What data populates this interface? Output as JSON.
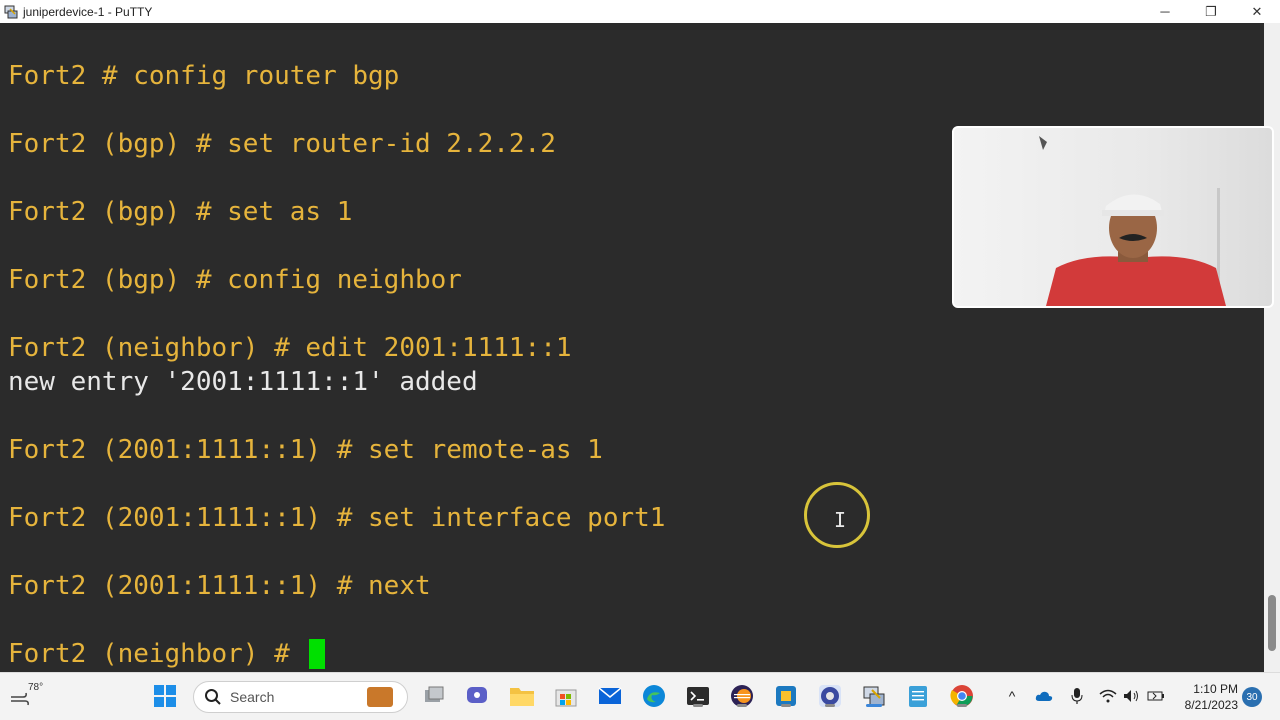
{
  "window": {
    "title": "juniperdevice-1 - PuTTY",
    "minimize_label": "─",
    "maximize_label": "❐",
    "close_label": "✕"
  },
  "terminal": {
    "lines": [
      {
        "text": "Fort2 # config router bgp",
        "kind": "prompt"
      },
      {
        "text": "Fort2 (bgp) # set router-id 2.2.2.2",
        "kind": "prompt"
      },
      {
        "text": "Fort2 (bgp) # set as 1",
        "kind": "prompt"
      },
      {
        "text": "Fort2 (bgp) # config neighbor",
        "kind": "prompt"
      },
      {
        "text": "Fort2 (neighbor) # edit 2001:1111::1",
        "kind": "prompt"
      },
      {
        "text": "new entry '2001:1111::1' added",
        "kind": "output"
      },
      {
        "text": "Fort2 (2001:1111::1) # set remote-as 1",
        "kind": "prompt"
      },
      {
        "text": "Fort2 (2001:1111::1) # set interface port1",
        "kind": "prompt"
      },
      {
        "text": "Fort2 (2001:1111::1) # next",
        "kind": "prompt"
      },
      {
        "text": "Fort2 (neighbor) # ",
        "kind": "prompt"
      }
    ]
  },
  "taskbar": {
    "weather_temp": "78°",
    "search_label": "Search",
    "apps": [
      "windows-start-icon",
      "search-icon",
      "task-view-icon",
      "teams-icon",
      "file-explorer-icon",
      "microsoft-store-icon",
      "mail-icon",
      "edge-icon",
      "terminal-icon",
      "eclipse-icon",
      "virtualbox-icon",
      "obs-icon",
      "putty-icon",
      "notepad-icon",
      "chrome-icon"
    ],
    "time": "1:10 PM",
    "date": "8/21/2023",
    "notification_count": "30"
  },
  "colors": {
    "prompt_text": "#e6b43c",
    "output_text": "#e8e8e8",
    "cursor_block": "#00e000",
    "terminal_bg": "#2b2b2b",
    "taskbar_bg": "#f3f3f3"
  }
}
